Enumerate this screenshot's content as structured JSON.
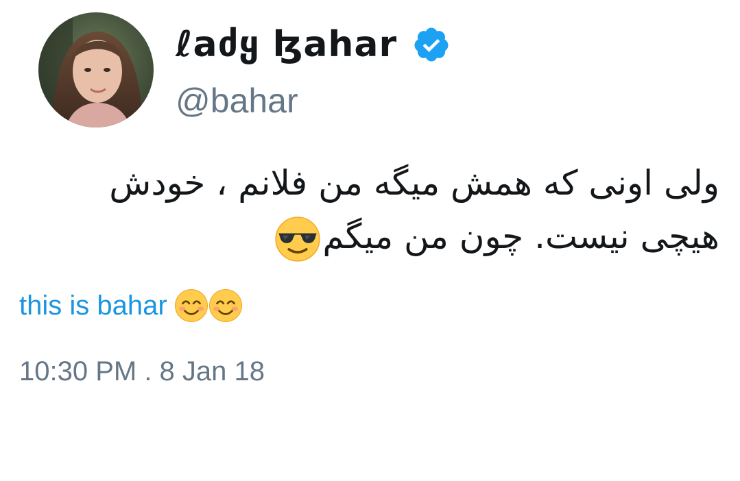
{
  "author": {
    "display_name": "ℓaძყ ɮahar",
    "handle": "@bahar",
    "verified": true,
    "avatar_icon": "profile-photo"
  },
  "tweet": {
    "lines": [
      "ولی اونی که همش میگه من فلانم ، خودش",
      "هیچی نیست. چون من میگم"
    ],
    "line_end_emoji": "smiling-face-with-sunglasses"
  },
  "link": {
    "text": "this is bahar",
    "emoji": [
      "smiling-face-with-smiling-eyes",
      "smiling-face-with-smiling-eyes"
    ]
  },
  "meta": {
    "timestamp": "10:30 PM . 8 Jan 18"
  },
  "colors": {
    "text_primary": "#14171a",
    "text_secondary": "#657786",
    "link": "#1b95e0",
    "verified_badge": "#1da1f2",
    "background": "#ffffff"
  }
}
